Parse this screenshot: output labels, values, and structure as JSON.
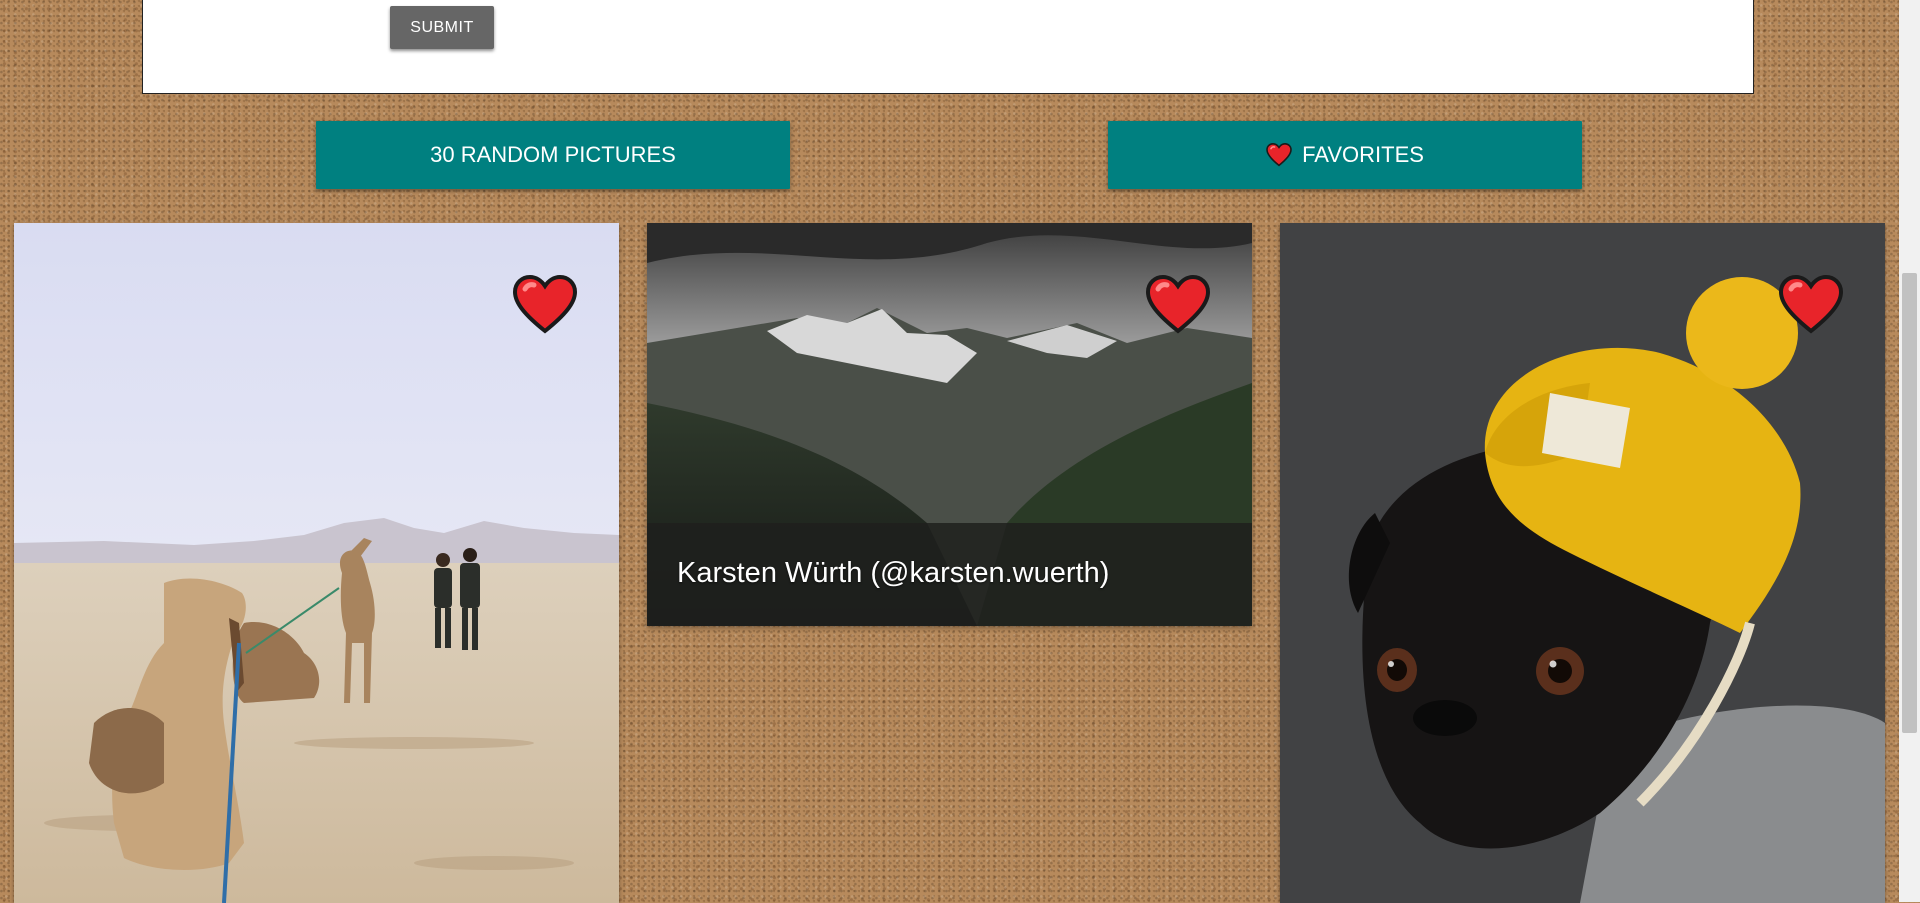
{
  "form": {
    "submit_label": "SUBMIT"
  },
  "actions": {
    "random_label": "30 RANDOM PICTURES",
    "favorites_label": "FAVORITES"
  },
  "cards": [
    {
      "caption": ""
    },
    {
      "caption": "Karsten Würth (@karsten.wuerth)"
    },
    {
      "caption": ""
    }
  ],
  "colors": {
    "teal": "#008080",
    "heart_red": "#e8242a",
    "cork": "#b78a5c",
    "submit_gray": "#666666"
  },
  "icons": {
    "favorite": "heart-icon"
  }
}
